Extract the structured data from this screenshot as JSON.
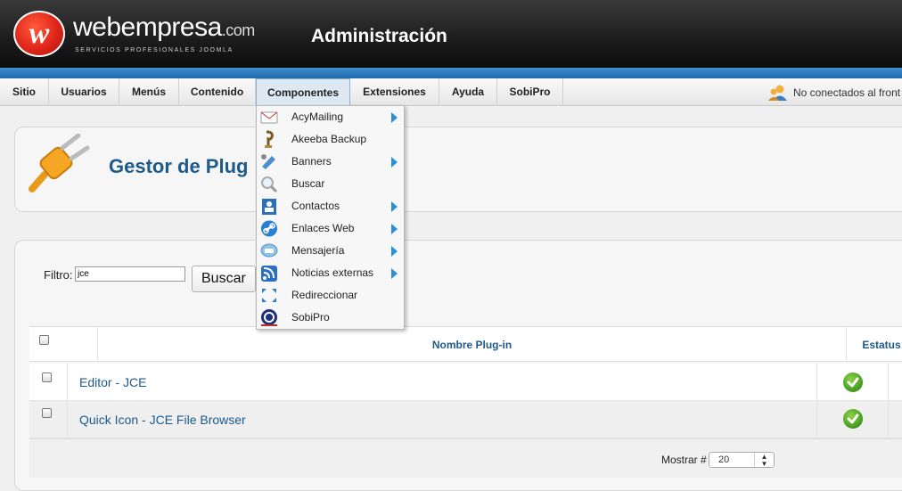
{
  "header": {
    "logo_letter": "w",
    "logo_name": "webempresa",
    "logo_domain": ".com",
    "logo_tagline": "SERVICIOS PROFESIONALES JOOMLA",
    "title": "Administración"
  },
  "menu": {
    "items": [
      "Sitio",
      "Usuarios",
      "Menús",
      "Contenido",
      "Componentes",
      "Extensiones",
      "Ayuda",
      "SobiPro"
    ],
    "active": "Componentes",
    "status_text": "No conectados al front"
  },
  "page": {
    "title": "Gestor de Plug"
  },
  "filter": {
    "label": "Filtro:",
    "value": "jce",
    "search_button": "Buscar"
  },
  "table": {
    "columns": [
      "Nombre Plug-in",
      "Estatus"
    ],
    "rows": [
      {
        "name": "Editor - JCE",
        "status": "enabled"
      },
      {
        "name": "Quick Icon - JCE File Browser",
        "status": "enabled"
      }
    ]
  },
  "pagination": {
    "show_label": "Mostrar #",
    "show_value": "20"
  },
  "dropdown": {
    "items": [
      {
        "label": "AcyMailing",
        "icon": "acymailing-icon",
        "submenu": true
      },
      {
        "label": "Akeeba Backup",
        "icon": "akeeba-icon",
        "submenu": false
      },
      {
        "label": "Banners",
        "icon": "banners-icon",
        "submenu": true
      },
      {
        "label": "Buscar",
        "icon": "search-icon",
        "submenu": false
      },
      {
        "label": "Contactos",
        "icon": "contacts-icon",
        "submenu": true
      },
      {
        "label": "Enlaces Web",
        "icon": "weblinks-icon",
        "submenu": true
      },
      {
        "label": "Mensajería",
        "icon": "messaging-icon",
        "submenu": true
      },
      {
        "label": "Noticias externas",
        "icon": "newsfeeds-icon",
        "submenu": true
      },
      {
        "label": "Redireccionar",
        "icon": "redirect-icon",
        "submenu": false
      },
      {
        "label": "SobiPro",
        "icon": "sobipro-icon",
        "submenu": false
      }
    ]
  },
  "colors": {
    "accent": "#1e5a8a",
    "header_blue": "#2a7bbf",
    "submenu_arrow": "#2a8fd6",
    "status_ok": "#3f9a1c"
  }
}
